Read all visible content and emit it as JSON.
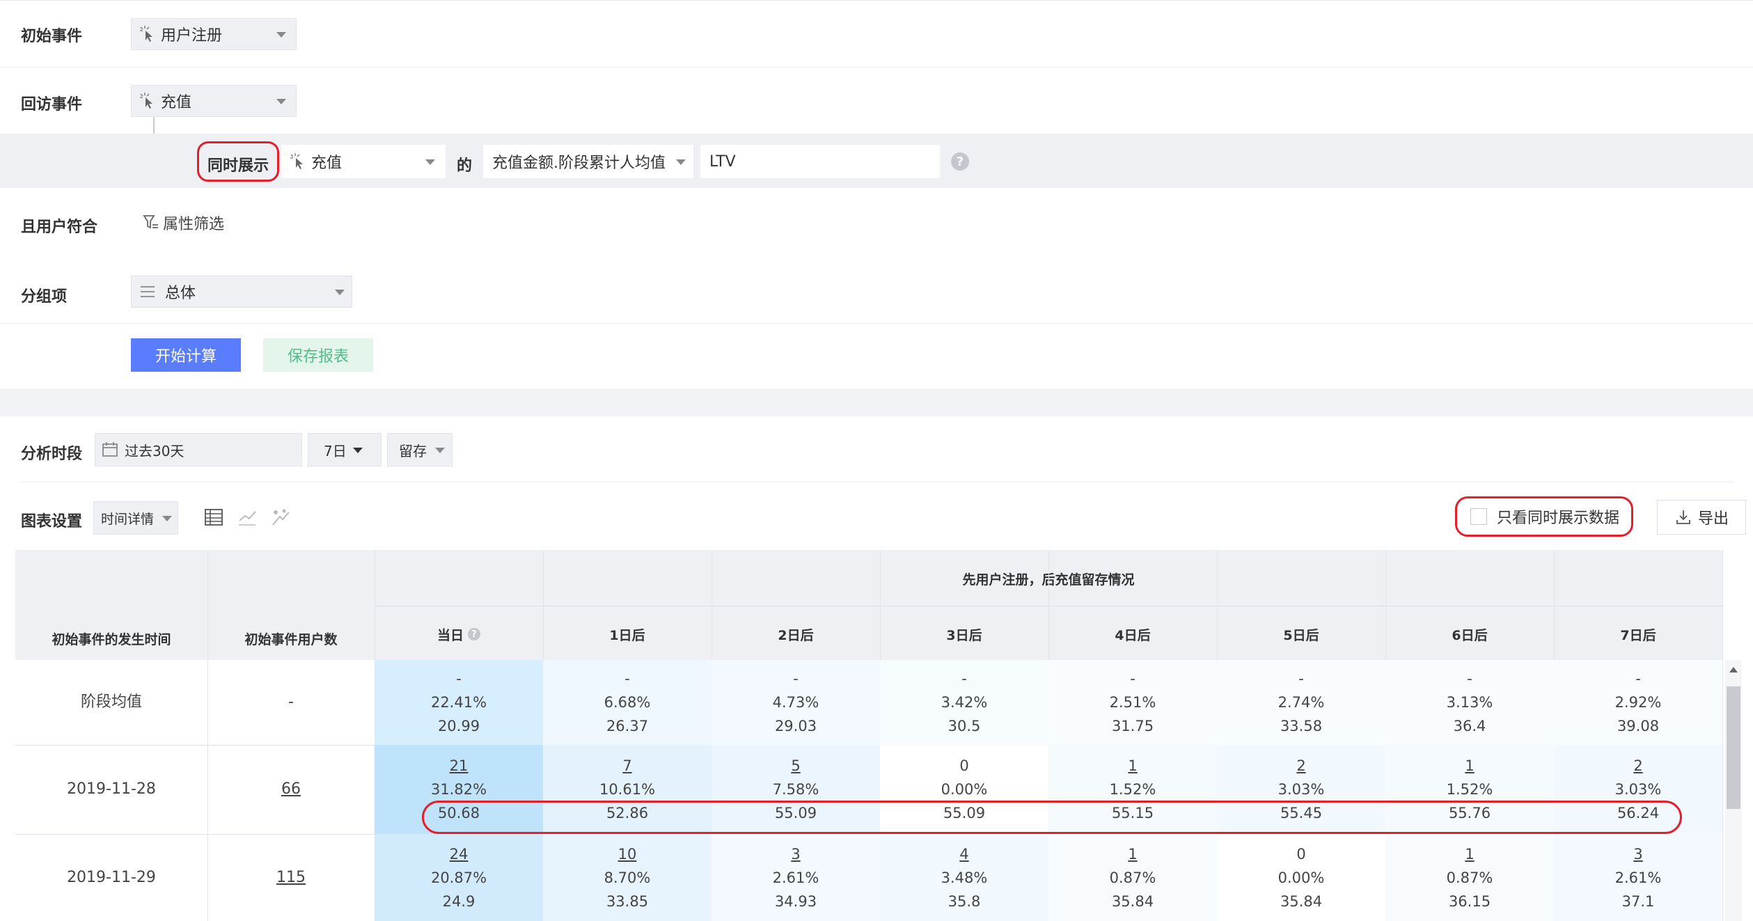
{
  "query": {
    "initial_event_label": "初始事件",
    "initial_event_value": "用户注册",
    "return_event_label": "回访事件",
    "return_event_value": "充值",
    "simul_label": "同时展示",
    "simul_event_value": "充值",
    "of_label": "的",
    "metric_value": "充值金额.阶段累计人均值",
    "alias_value": "LTV",
    "user_filter_label": "且用户符合",
    "attr_filter_label": "属性筛选",
    "group_label": "分组项",
    "group_value": "总体",
    "calc_button": "开始计算",
    "save_button": "保存报表"
  },
  "analysis": {
    "period_label": "分析时段",
    "period_value": "过去30天",
    "granularity": "7日",
    "type": "留存",
    "chart_settings_label": "图表设置",
    "chart_mode": "时间详情",
    "only_simul_label": "只看同时展示数据",
    "export_label": "导出"
  },
  "table": {
    "group_header": "先用户注册，后充值留存情况",
    "col_time": "初始事件的发生时间",
    "col_users": "初始事件用户数",
    "days": [
      "当日",
      "1日后",
      "2日后",
      "3日后",
      "4日后",
      "5日后",
      "6日后",
      "7日后"
    ],
    "rows": [
      {
        "time": "阶段均值",
        "users": "-",
        "cells": [
          [
            "-",
            "22.41%",
            "20.99"
          ],
          [
            "-",
            "6.68%",
            "26.37"
          ],
          [
            "-",
            "4.73%",
            "29.03"
          ],
          [
            "-",
            "3.42%",
            "30.5"
          ],
          [
            "-",
            "2.51%",
            "31.75"
          ],
          [
            "-",
            "2.74%",
            "33.58"
          ],
          [
            "-",
            "3.13%",
            "36.4"
          ],
          [
            "-",
            "2.92%",
            "39.08"
          ]
        ]
      },
      {
        "time": "2019-11-28",
        "users": "66",
        "cells": [
          [
            "21",
            "31.82%",
            "50.68"
          ],
          [
            "7",
            "10.61%",
            "52.86"
          ],
          [
            "5",
            "7.58%",
            "55.09"
          ],
          [
            "0",
            "0.00%",
            "55.09"
          ],
          [
            "1",
            "1.52%",
            "55.15"
          ],
          [
            "2",
            "3.03%",
            "55.45"
          ],
          [
            "1",
            "1.52%",
            "55.76"
          ],
          [
            "2",
            "3.03%",
            "56.24"
          ]
        ]
      },
      {
        "time": "2019-11-29",
        "users": "115",
        "cells": [
          [
            "24",
            "20.87%",
            "24.9"
          ],
          [
            "10",
            "8.70%",
            "33.85"
          ],
          [
            "3",
            "2.61%",
            "34.93"
          ],
          [
            "4",
            "3.48%",
            "35.8"
          ],
          [
            "1",
            "0.87%",
            "35.84"
          ],
          [
            "0",
            "0.00%",
            "35.84"
          ],
          [
            "1",
            "0.87%",
            "36.15"
          ],
          [
            "3",
            "2.61%",
            "37.1"
          ]
        ]
      }
    ]
  }
}
